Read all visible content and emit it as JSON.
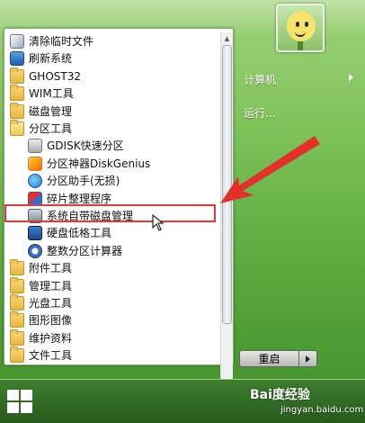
{
  "menu": {
    "items": [
      {
        "label": "清除临时文件",
        "icon": "broom-icon",
        "kind": "app"
      },
      {
        "label": "刷新系统",
        "icon": "refresh-icon",
        "kind": "app"
      },
      {
        "label": "GHOST32",
        "icon": "folder-icon",
        "kind": "folder"
      },
      {
        "label": "WIM工具",
        "icon": "folder-icon",
        "kind": "folder"
      },
      {
        "label": "磁盘管理",
        "icon": "folder-icon",
        "kind": "folder"
      },
      {
        "label": "分区工具",
        "icon": "folder-open-icon",
        "kind": "folder"
      },
      {
        "label": "GDISK快速分区",
        "icon": "gdisk-icon",
        "kind": "app"
      },
      {
        "label": "分区神器DiskGenius",
        "icon": "diskgenius-icon",
        "kind": "app"
      },
      {
        "label": "分区助手(无损)",
        "icon": "partition-assistant-icon",
        "kind": "app"
      },
      {
        "label": "碎片整理程序",
        "icon": "defrag-icon",
        "kind": "app"
      },
      {
        "label": "系统自带磁盘管理",
        "icon": "disk-management-icon",
        "kind": "app"
      },
      {
        "label": "硬盘低格工具",
        "icon": "low-format-icon",
        "kind": "app"
      },
      {
        "label": "整数分区计算器",
        "icon": "calculator-icon",
        "kind": "app"
      },
      {
        "label": "附件工具",
        "icon": "folder-icon",
        "kind": "folder"
      },
      {
        "label": "管理工具",
        "icon": "folder-icon",
        "kind": "folder"
      },
      {
        "label": "光盘工具",
        "icon": "folder-icon",
        "kind": "folder"
      },
      {
        "label": "图形图像",
        "icon": "folder-icon",
        "kind": "folder"
      },
      {
        "label": "维护资料",
        "icon": "folder-icon",
        "kind": "folder"
      },
      {
        "label": "文件工具",
        "icon": "folder-icon",
        "kind": "folder"
      }
    ],
    "highlighted_index": 10
  },
  "right_pane": {
    "computer": "计算机",
    "run": "运行..."
  },
  "power": {
    "restart": "重启"
  },
  "watermark": {
    "main": "Bai度经验",
    "sub": "jingyan.baidu.com"
  },
  "colors": {
    "highlight_border": "#e23a3a",
    "accent_green": "#5aa83c"
  }
}
